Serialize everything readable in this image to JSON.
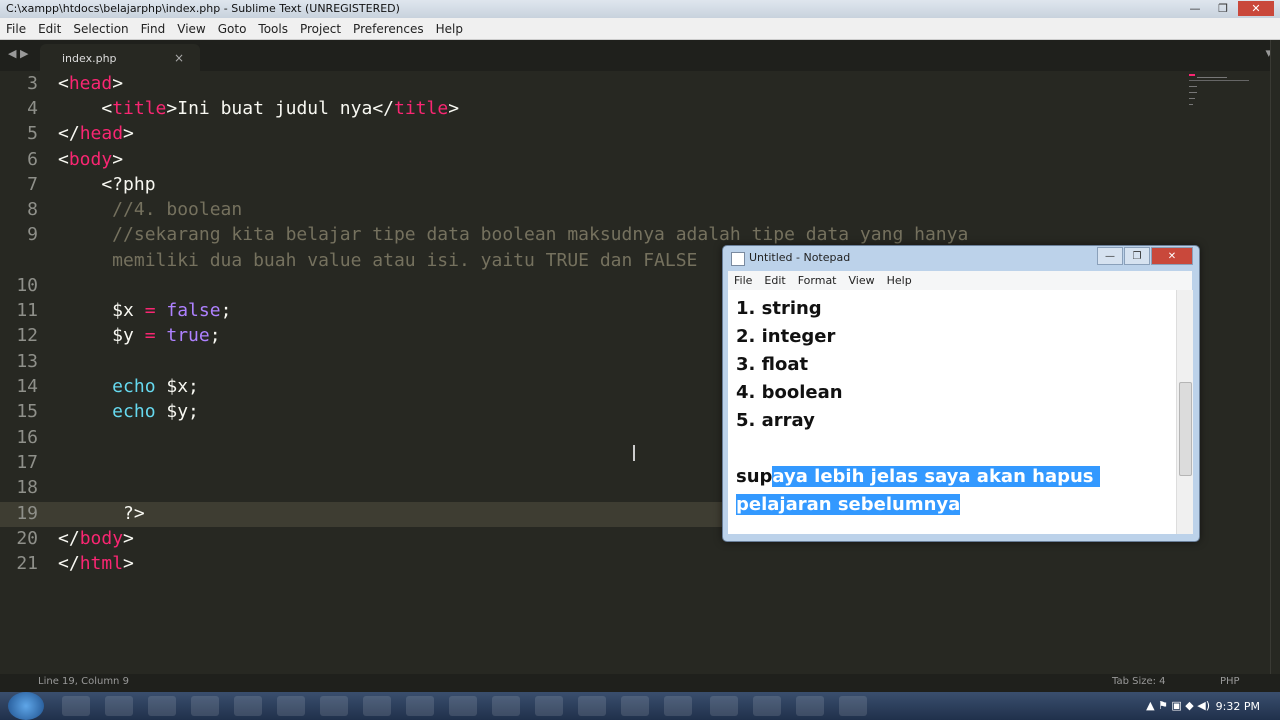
{
  "window": {
    "title": "C:\\xampp\\htdocs\\belajarphp\\index.php - Sublime Text (UNREGISTERED)",
    "minimize": "—",
    "maximize": "❐",
    "close": "✕"
  },
  "menu": [
    "File",
    "Edit",
    "Selection",
    "Find",
    "View",
    "Goto",
    "Tools",
    "Project",
    "Preferences",
    "Help"
  ],
  "tab": {
    "nav": "◀ ▶",
    "label": "index.php",
    "close": "×",
    "dropdown": "▾"
  },
  "editor": {
    "line_numbers": [
      "3",
      "4",
      "5",
      "6",
      "7",
      "8",
      "9",
      "",
      "10",
      "11",
      "12",
      "13",
      "14",
      "15",
      "16",
      "17",
      "18",
      "19",
      "20",
      "21"
    ],
    "lines": {
      "l3": {
        "open": "<",
        "tag": "head",
        "close": ">"
      },
      "l4": {
        "indent": "    ",
        "open": "<",
        "tag": "title",
        "close": ">",
        "text": "Ini buat judul nya",
        "open2": "</",
        "tag2": "title",
        "close2": ">"
      },
      "l5": {
        "open": "</",
        "tag": "head",
        "close": ">"
      },
      "l6": {
        "open": "<",
        "tag": "body",
        "close": ">"
      },
      "l7": {
        "text": "    <?php"
      },
      "l8": {
        "text": "     //4. boolean"
      },
      "l9a": {
        "text": "     //sekarang kita belajar tipe data boolean maksudnya adalah tipe data yang hanya"
      },
      "l9b": {
        "text": "     memiliki dua buah value atau isi. yaitu TRUE dan FALSE"
      },
      "l11": {
        "var": "     $x",
        "op": " = ",
        "val": "false",
        "end": ";"
      },
      "l12": {
        "var": "     $y",
        "op": " = ",
        "val": "true",
        "end": ";"
      },
      "l14": {
        "fn": "     echo",
        "rest": " $x;"
      },
      "l15": {
        "fn": "     echo",
        "rest": " $y;"
      },
      "l19": {
        "text": "      ?>"
      },
      "l20": {
        "open": "</",
        "tag": "body",
        "close": ">"
      },
      "l21": {
        "open": "</",
        "tag": "html",
        "close": ">"
      }
    }
  },
  "status": {
    "position": "Line 19, Column 9",
    "tabsize": "Tab Size: 4",
    "syntax": "PHP"
  },
  "notepad": {
    "title": "Untitled - Notepad",
    "minimize": "—",
    "maximize": "❐",
    "close": "✕",
    "menu": [
      "File",
      "Edit",
      "Format",
      "View",
      "Help"
    ],
    "list": [
      "1. string",
      "2. integer",
      "3. float",
      "4. boolean",
      "5. array"
    ],
    "para_plain": "sup",
    "para_sel1": "aya lebih jelas saya akan hapus ",
    "para_sel2": "pelajaran sebelumnya"
  },
  "taskbar": {
    "clock": "9:32 PM",
    "tray": "▲ ⚑ ▣ ◆ ◀)"
  },
  "colors": {
    "bg": "#272822",
    "tag": "#f92672",
    "comment": "#75715e",
    "keyword": "#ae81ff",
    "function": "#66d9ef",
    "selection": "#3399ff"
  }
}
